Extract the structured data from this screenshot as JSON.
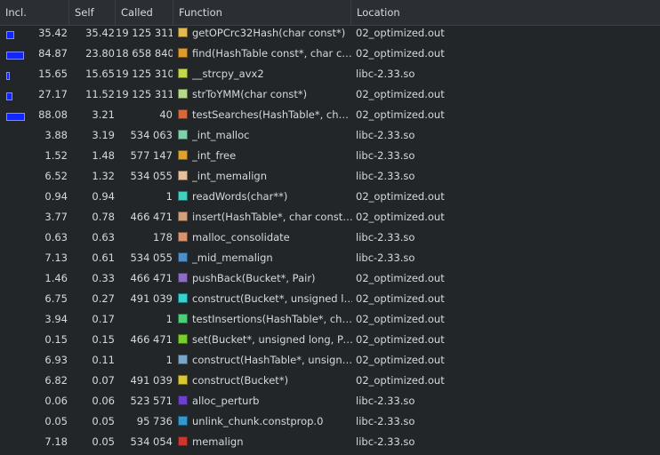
{
  "columns": {
    "incl": "Incl.",
    "self": "Self",
    "called": "Called",
    "function": "Function",
    "location": "Location"
  },
  "rows": [
    {
      "incl": "35.42",
      "self": "35.42",
      "called": "19 125 311",
      "function": "getOPCrc32Hash(char const*)",
      "location": "02_optimized.out",
      "color": "#e3b84f",
      "incl_frac": 0.3542,
      "self_frac": 0.3542
    },
    {
      "incl": "84.87",
      "self": "23.80",
      "called": "18 658 840",
      "function": "find(HashTable const*, char con...",
      "location": "02_optimized.out",
      "color": "#e09a2c",
      "incl_frac": 0.8487,
      "self_frac": 0.238
    },
    {
      "incl": "15.65",
      "self": "15.65",
      "called": "19 125 310",
      "function": "__strcpy_avx2",
      "location": "libc-2.33.so",
      "color": "#c6d84a",
      "incl_frac": 0.1565,
      "self_frac": 0.1565
    },
    {
      "incl": "27.17",
      "self": "11.52",
      "called": "19 125 311",
      "function": "strToYMM(char const*)",
      "location": "02_optimized.out",
      "color": "#b9d98a",
      "incl_frac": 0.2717,
      "self_frac": 0.1152
    },
    {
      "incl": "88.08",
      "self": "3.21",
      "called": "40",
      "function": "testSearches(HashTable*, char ...",
      "location": "02_optimized.out",
      "color": "#d8683a",
      "incl_frac": 0.8808,
      "self_frac": 0
    },
    {
      "incl": "3.88",
      "self": "3.19",
      "called": "534 063",
      "function": "_int_malloc",
      "location": "libc-2.33.so",
      "color": "#7ed1a9",
      "incl_frac": 0,
      "self_frac": 0
    },
    {
      "incl": "1.52",
      "self": "1.48",
      "called": "577 147",
      "function": "_int_free",
      "location": "libc-2.33.so",
      "color": "#e0a22f",
      "incl_frac": 0,
      "self_frac": 0
    },
    {
      "incl": "6.52",
      "self": "1.32",
      "called": "534 055",
      "function": "_int_memalign",
      "location": "libc-2.33.so",
      "color": "#e6bf9b",
      "incl_frac": 0,
      "self_frac": 0
    },
    {
      "incl": "0.94",
      "self": "0.94",
      "called": "1",
      "function": "readWords(char**)",
      "location": "02_optimized.out",
      "color": "#3fd1c0",
      "incl_frac": 0,
      "self_frac": 0
    },
    {
      "incl": "3.77",
      "self": "0.78",
      "called": "466 471",
      "function": "insert(HashTable*, char const*, ...",
      "location": "02_optimized.out",
      "color": "#d2a07a",
      "incl_frac": 0,
      "self_frac": 0
    },
    {
      "incl": "0.63",
      "self": "0.63",
      "called": "178",
      "function": "malloc_consolidate",
      "location": "libc-2.33.so",
      "color": "#d9926c",
      "incl_frac": 0,
      "self_frac": 0
    },
    {
      "incl": "7.13",
      "self": "0.61",
      "called": "534 055",
      "function": "_mid_memalign",
      "location": "libc-2.33.so",
      "color": "#4a8fc9",
      "incl_frac": 0,
      "self_frac": 0
    },
    {
      "incl": "1.46",
      "self": "0.33",
      "called": "466 471",
      "function": "pushBack(Bucket*, Pair)",
      "location": "02_optimized.out",
      "color": "#8d6bc7",
      "incl_frac": 0,
      "self_frac": 0
    },
    {
      "incl": "6.75",
      "self": "0.27",
      "called": "491 039",
      "function": "construct(Bucket*, unsigned long)",
      "location": "02_optimized.out",
      "color": "#34d2d2",
      "incl_frac": 0,
      "self_frac": 0
    },
    {
      "incl": "3.94",
      "self": "0.17",
      "called": "1",
      "function": "testInsertions(HashTable*, char...",
      "location": "02_optimized.out",
      "color": "#49d17a",
      "incl_frac": 0,
      "self_frac": 0
    },
    {
      "incl": "0.15",
      "self": "0.15",
      "called": "466 471",
      "function": "set(Bucket*, unsigned long, Pair)",
      "location": "02_optimized.out",
      "color": "#78cf2c",
      "incl_frac": 0,
      "self_frac": 0
    },
    {
      "incl": "6.93",
      "self": "0.11",
      "called": "1",
      "function": "construct(HashTable*, unsigne...",
      "location": "02_optimized.out",
      "color": "#7aa6c9",
      "incl_frac": 0,
      "self_frac": 0
    },
    {
      "incl": "6.82",
      "self": "0.07",
      "called": "491 039",
      "function": "construct(Bucket*)",
      "location": "02_optimized.out",
      "color": "#d9c630",
      "incl_frac": 0,
      "self_frac": 0
    },
    {
      "incl": "0.06",
      "self": "0.06",
      "called": "523 571",
      "function": "alloc_perturb",
      "location": "libc-2.33.so",
      "color": "#6d3fd0",
      "incl_frac": 0,
      "self_frac": 0
    },
    {
      "incl": "0.05",
      "self": "0.05",
      "called": "95 736",
      "function": "unlink_chunk.constprop.0",
      "location": "libc-2.33.so",
      "color": "#2e9ad1",
      "incl_frac": 0,
      "self_frac": 0
    },
    {
      "incl": "7.18",
      "self": "0.05",
      "called": "534 054",
      "function": "memalign",
      "location": "libc-2.33.so",
      "color": "#d0352b",
      "incl_frac": 0,
      "self_frac": 0
    }
  ]
}
